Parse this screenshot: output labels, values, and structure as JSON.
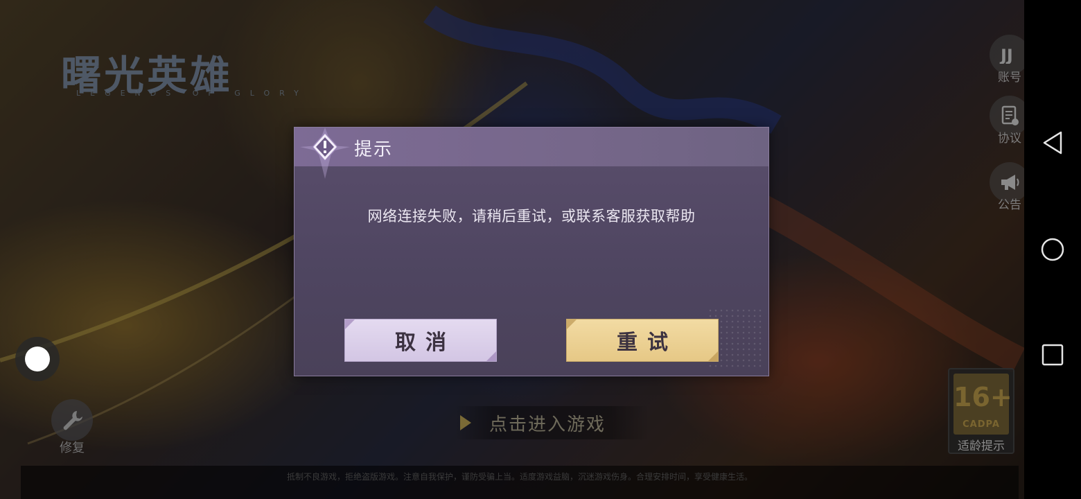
{
  "game": {
    "logo_title": "曙光英雄",
    "logo_subtitle": "LEGENDS OF GLORY",
    "enter_label": "点击进入游戏",
    "repair_label": "修复",
    "age_rating": {
      "number": "16+",
      "org": "CADPA",
      "label": "适龄提示"
    },
    "footer_text": "抵制不良游戏，拒绝盗版游戏。注意自我保护，谨防受骗上当。适度游戏益脑，沉迷游戏伤身。合理安排时间，享受健康生活。"
  },
  "side_buttons": [
    {
      "label": "账号",
      "icon": "account-icon"
    },
    {
      "label": "协议",
      "icon": "agreement-icon"
    },
    {
      "label": "公告",
      "icon": "megaphone-icon"
    }
  ],
  "dialog": {
    "title": "提示",
    "message": "网络连接失败，请稍后重试，或联系客服获取帮助",
    "cancel_label": "取消",
    "retry_label": "重试"
  },
  "system_nav": {
    "back": "back-icon",
    "home": "home-icon",
    "recents": "recents-icon"
  },
  "colors": {
    "dialog_bg": "#4e4560",
    "dialog_header": "#7d6b95",
    "cancel_button": "#dccfec",
    "retry_button": "#ecd196"
  }
}
